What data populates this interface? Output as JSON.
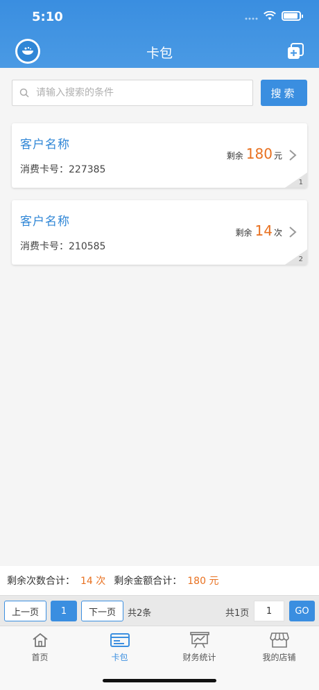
{
  "status": {
    "time": "5:10"
  },
  "header": {
    "title": "卡包"
  },
  "search": {
    "placeholder": "请输入搜索的条件",
    "button": "搜索"
  },
  "cards": [
    {
      "name": "客户名称",
      "cardno_label": "消费卡号：",
      "cardno": "227385",
      "remain_label": "剩余",
      "remain_value": "180",
      "remain_unit": "元",
      "index": "1"
    },
    {
      "name": "客户名称",
      "cardno_label": "消费卡号：",
      "cardno": "210585",
      "remain_label": "剩余",
      "remain_value": "14",
      "remain_unit": "次",
      "index": "2"
    }
  ],
  "totals": {
    "times_label": "剩余次数合计：",
    "times_value": "14 次",
    "amount_label": "剩余金额合计：",
    "amount_value": "180 元"
  },
  "pager": {
    "prev": "上一页",
    "current": "1",
    "next": "下一页",
    "total_items": "共2条",
    "total_pages": "共1页",
    "goto_value": "1",
    "go": "GO"
  },
  "tabs": [
    {
      "label": "首页"
    },
    {
      "label": "卡包"
    },
    {
      "label": "财务统计"
    },
    {
      "label": "我的店铺"
    }
  ],
  "colors": {
    "primary": "#3a8ee0",
    "accent": "#e8701f"
  }
}
